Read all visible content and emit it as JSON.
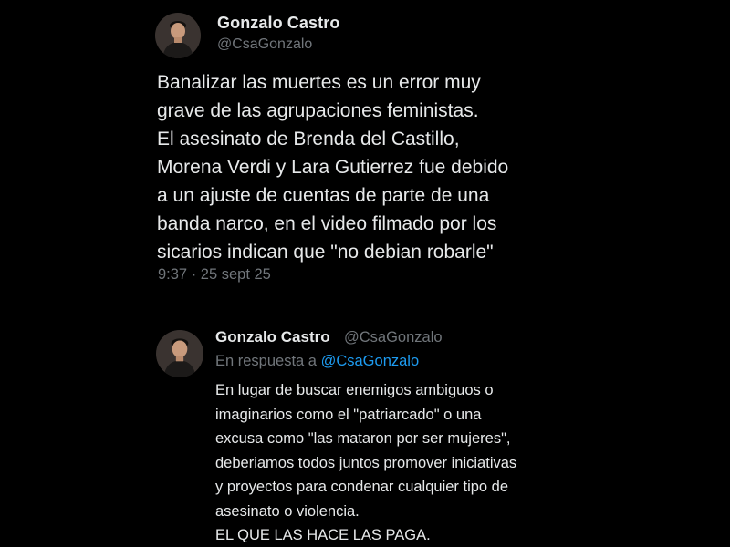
{
  "main_tweet": {
    "author_name": "Gonzalo Castro",
    "author_handle": "@CsaGonzalo",
    "text_lines": [
      "Banalizar las muertes es un error muy",
      "grave de las agrupaciones feministas.",
      "El asesinato de Brenda del Castillo,",
      "Morena Verdi y Lara Gutierrez fue debido",
      "a un ajuste de cuentas de parte de una",
      "banda narco, en el video filmado por los",
      "sicarios indican que \"no debian robarle\""
    ],
    "timestamp": "9:37 · 25 sept 25"
  },
  "reply_tweet": {
    "author_name": "Gonzalo Castro",
    "author_handle": "@CsaGonzalo",
    "reply_prefix": "En respuesta a",
    "reply_to": "@CsaGonzalo",
    "text_lines": [
      "En lugar de buscar enemigos ambiguos o",
      "imaginarios como el \"patriarcado\" o una",
      "excusa como \"las mataron por ser mujeres\",",
      "deberiamos todos juntos promover iniciativas",
      "y proyectos para condenar cualquier tipo de",
      "asesinato o violencia.",
      "EL QUE LAS HACE LAS PAGA."
    ]
  },
  "colors": {
    "background": "#000000",
    "primary_text": "#e7e9ea",
    "secondary_text": "#71767b",
    "link": "#1d9bf0"
  },
  "icons": {
    "main_avatar": "user-avatar-icon",
    "reply_avatar": "user-avatar-icon"
  }
}
